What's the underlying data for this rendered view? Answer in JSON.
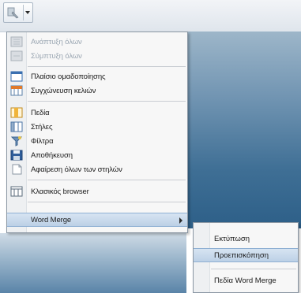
{
  "menu": {
    "items": [
      {
        "label": "Ανάπτυξη όλων",
        "disabled": true,
        "icon": "expand-all-icon"
      },
      {
        "label": "Σύμπτυξη όλων",
        "disabled": true,
        "icon": "collapse-all-icon"
      },
      {
        "label": "Πλαίσιο ομαδοποίησης",
        "disabled": false,
        "icon": "group-box-icon"
      },
      {
        "label": "Συγχώνευση κελιών",
        "disabled": false,
        "icon": "merge-cells-icon"
      },
      {
        "label": "Πεδία",
        "disabled": false,
        "icon": "fields-icon"
      },
      {
        "label": "Στήλες",
        "disabled": false,
        "icon": "columns-icon"
      },
      {
        "label": "Φίλτρα",
        "disabled": false,
        "icon": "filter-icon"
      },
      {
        "label": "Αποθήκευση",
        "disabled": false,
        "icon": "save-icon"
      },
      {
        "label": "Αφαίρεση όλων των στηλών",
        "disabled": false,
        "icon": "remove-columns-icon"
      },
      {
        "label": "Κλασικός browser",
        "underline_part": "b",
        "disabled": false,
        "icon": "classic-browser-icon"
      },
      {
        "label": "Word Merge",
        "disabled": false,
        "highlighted": true,
        "has_submenu": true
      }
    ]
  },
  "submenu": {
    "items": [
      {
        "label": "Εκτύπωση"
      },
      {
        "label": "Προεπισκόπηση",
        "highlighted": true
      },
      {
        "label": "Πεδία Word Merge"
      }
    ]
  },
  "colors": {
    "highlight": "#bcd0e6",
    "menu_bg": "#f7f7f7",
    "disabled_text": "#9aa6b2"
  }
}
